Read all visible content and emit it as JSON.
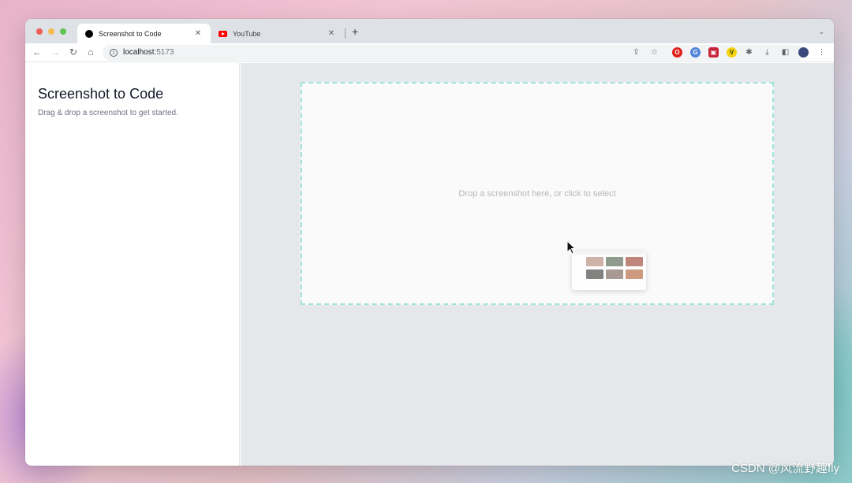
{
  "browser": {
    "tabs": [
      {
        "title": "Screenshot to Code",
        "icon": "black-circle-favicon"
      },
      {
        "title": "YouTube",
        "icon": "youtube-favicon"
      }
    ],
    "url_host": "localhost",
    "url_port": ":5173"
  },
  "app": {
    "title": "Screenshot to Code",
    "subtitle": "Drag & drop a screenshot to get started.",
    "dropzone_hint": "Drop a screenshot here, or click to select"
  },
  "watermark": "CSDN @风流野趣fly",
  "colors": {
    "dropzone_border": "#9fe5d6",
    "main_bg": "#e5e7eb"
  }
}
